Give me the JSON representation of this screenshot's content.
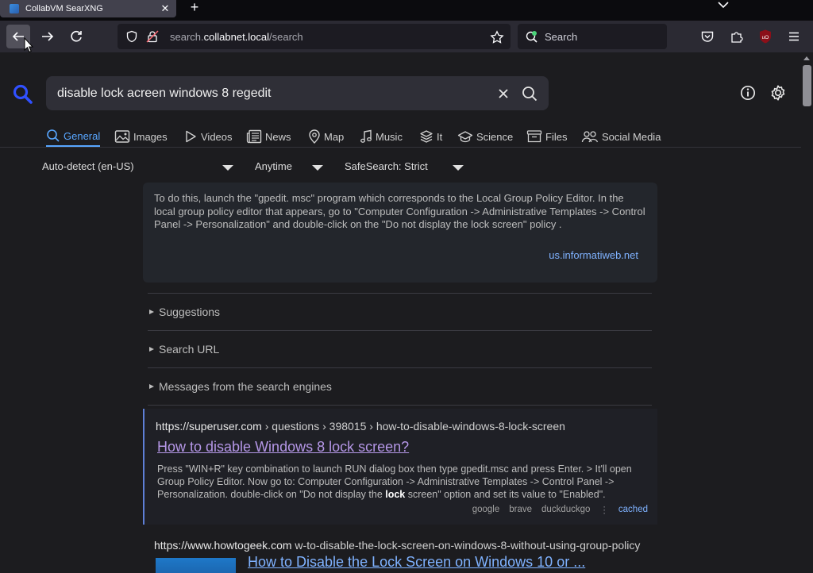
{
  "tab": {
    "title": "CollabVM SearXNG"
  },
  "navbar": {
    "url_scheme_host_prefix": "search.",
    "url_host": "collabnet.local",
    "url_path": "/search",
    "search_placeholder": "Search"
  },
  "search": {
    "query": "disable lock acreen windows 8 regedit"
  },
  "categories": [
    {
      "label": "General",
      "icon": "search-icon",
      "active": true
    },
    {
      "label": "Images",
      "icon": "image-icon",
      "active": false
    },
    {
      "label": "Videos",
      "icon": "play-icon",
      "active": false
    },
    {
      "label": "News",
      "icon": "newspaper-icon",
      "active": false
    },
    {
      "label": "Map",
      "icon": "map-pin-icon",
      "active": false
    },
    {
      "label": "Music",
      "icon": "music-note-icon",
      "active": false
    },
    {
      "label": "It",
      "icon": "layers-icon",
      "active": false
    },
    {
      "label": "Science",
      "icon": "graduation-cap-icon",
      "active": false
    },
    {
      "label": "Files",
      "icon": "file-box-icon",
      "active": false
    },
    {
      "label": "Social Media",
      "icon": "people-icon",
      "active": false
    }
  ],
  "filters": {
    "language": "Auto-detect (en-US)",
    "time": "Anytime",
    "safesearch": "SafeSearch: Strict"
  },
  "infobox": {
    "answer": "To do this, launch the \"gpedit. msc\" program which corresponds to the Local Group Policy Editor. In the local group policy editor that appears, go to \"Computer Configuration -> Administrative Templates -> Control Panel -> Personalization\" and double-click on the \"Do not display the lock screen\" policy .",
    "source": "us.informatiweb.net"
  },
  "accordions": {
    "suggestions": "Suggestions",
    "search_url": "Search URL",
    "messages": "Messages from the search engines"
  },
  "results": [
    {
      "url": "https://superuser.com",
      "path": " › questions › 398015 › how-to-disable-windows-8-lock-screen",
      "title": "How to disable Windows 8 lock screen?",
      "snippet_before": "Press \"WIN+R\" key combination to launch RUN dialog box then type gpedit.msc and press Enter. > It'll open Group Policy Editor. Now go to: Computer Configuration -> Administrative Templates -> Control Panel -> Personalization. double-click on \"Do not display the ",
      "snippet_bold": "lock",
      "snippet_after": " screen\" option and set its value to \"Enabled\".",
      "engines": [
        "google",
        "brave",
        "duckduckgo"
      ],
      "cached_label": "cached"
    },
    {
      "url": "https://www.howtogeek.com",
      "path": " w-to-disable-the-lock-screen-on-windows-8-without-using-group-policy",
      "title": "How to Disable the Lock Screen on Windows 10 or ..."
    }
  ],
  "colors": {
    "accent": "#58a6ff",
    "visited_link": "#b496e6",
    "link": "#7fb2ff",
    "result_marker": "#5e7fd6"
  }
}
